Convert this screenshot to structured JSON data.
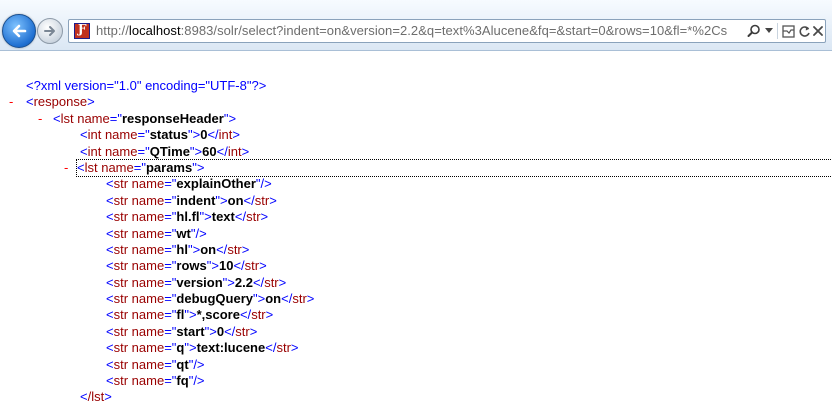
{
  "browser": {
    "url_scheme": "http://",
    "url_host": "localhost",
    "url_rest": ":8983/solr/select?indent=on&version=2.2&q=text%3Alucene&fq=&start=0&rows=10&fl=*%2Cs",
    "site_icon_glyph": "Ƒ"
  },
  "xml": {
    "declaration": "<?xml version=\"1.0\" encoding=\"UTF-8\"?>",
    "collapse_glyph": "-",
    "response_open": "response",
    "header_lst_name": "responseHeader",
    "status": {
      "elem": "int",
      "name": "status",
      "value": "0"
    },
    "qtime": {
      "elem": "int",
      "name": "QTime",
      "value": "60"
    },
    "params_lst_name": "params",
    "params": [
      {
        "name": "explainOther",
        "value": ""
      },
      {
        "name": "indent",
        "value": "on"
      },
      {
        "name": "hl.fl",
        "value": "text"
      },
      {
        "name": "wt",
        "value": ""
      },
      {
        "name": "hl",
        "value": "on"
      },
      {
        "name": "rows",
        "value": "10"
      },
      {
        "name": "version",
        "value": "2.2"
      },
      {
        "name": "debugQuery",
        "value": "on"
      },
      {
        "name": "fl",
        "value": "*,score"
      },
      {
        "name": "start",
        "value": "0"
      },
      {
        "name": "q",
        "value": "text:lucene"
      },
      {
        "name": "qt",
        "value": ""
      },
      {
        "name": "fq",
        "value": ""
      }
    ],
    "closing_lst": "/lst"
  }
}
